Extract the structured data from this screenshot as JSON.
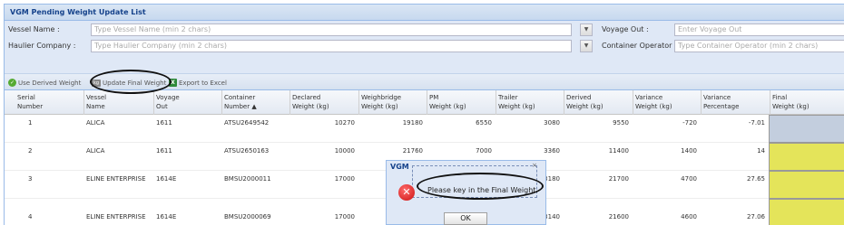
{
  "panel": {
    "title": "VGM Pending Weight Update List"
  },
  "form": {
    "vessel_name_label": "Vessel Name :",
    "vessel_name_placeholder": "Type Vessel Name (min 2 chars)",
    "voyage_out_label": "Voyage Out :",
    "voyage_out_placeholder": "Enter Voyage Out",
    "haulier_label": "Haulier Company :",
    "haulier_placeholder": "Type Haulier Company (min 2 chars)",
    "operator_label": "Container Operator :",
    "operator_placeholder": "Type Container Operator (min 2 chars)"
  },
  "toolbar": {
    "use_derived_label": "Use Derived Weight",
    "update_final_label": "Update Final Weight",
    "export_label": "Export to Excel"
  },
  "columns": [
    "Serial\nNumber",
    "Vessel\nName",
    "Voyage\nOut",
    "Container\nNumber ▲",
    "Declared\nWeight (kg)",
    "Weighbridge\nWeight (kg)",
    "PM\nWeight (kg)",
    "Trailer\nWeight (kg)",
    "Derived\nWeight (kg)",
    "Variance\nWeight (kg)",
    "Variance\nPercentage",
    "Final\nWeight (kg)"
  ],
  "rows": [
    {
      "serial": "1",
      "vessel": "ALICA",
      "voyage": "1611",
      "container": "ATSU2649542",
      "declared": "10270",
      "weighbridge": "19180",
      "pm": "6550",
      "trailer": "3080",
      "derived": "9550",
      "var_weight": "-720",
      "var_pct": "-7.01",
      "final_color": "#c3cede"
    },
    {
      "serial": "2",
      "vessel": "ALICA",
      "voyage": "1611",
      "container": "ATSU2650163",
      "declared": "10000",
      "weighbridge": "21760",
      "pm": "7000",
      "trailer": "3360",
      "derived": "11400",
      "var_weight": "1400",
      "var_pct": "14",
      "final_color": "#e4e45a"
    },
    {
      "serial": "3",
      "vessel": "ELINE ENTERPRISE",
      "voyage": "1614E",
      "container": "BMSU2000011",
      "declared": "17000",
      "weighbridge": "",
      "pm": "",
      "trailer": "3180",
      "derived": "21700",
      "var_weight": "4700",
      "var_pct": "27.65",
      "final_color": "#e4e45a"
    },
    {
      "serial": "4",
      "vessel": "ELINE ENTERPRISE",
      "voyage": "1614E",
      "container": "BMSU2000069",
      "declared": "17000",
      "weighbridge": "",
      "pm": "",
      "trailer": "3140",
      "derived": "21600",
      "var_weight": "4600",
      "var_pct": "27.06",
      "final_color": "#e4e45a"
    }
  ],
  "dialog": {
    "title": "VGM",
    "message": "Please key in the Final Weight.",
    "ok_label": "OK",
    "icon": "error-icon"
  },
  "colors": {
    "title_text": "#15428b",
    "header_bg": "#dfe8f6",
    "highlight": "#e4e45a",
    "error": "#cc1111"
  }
}
